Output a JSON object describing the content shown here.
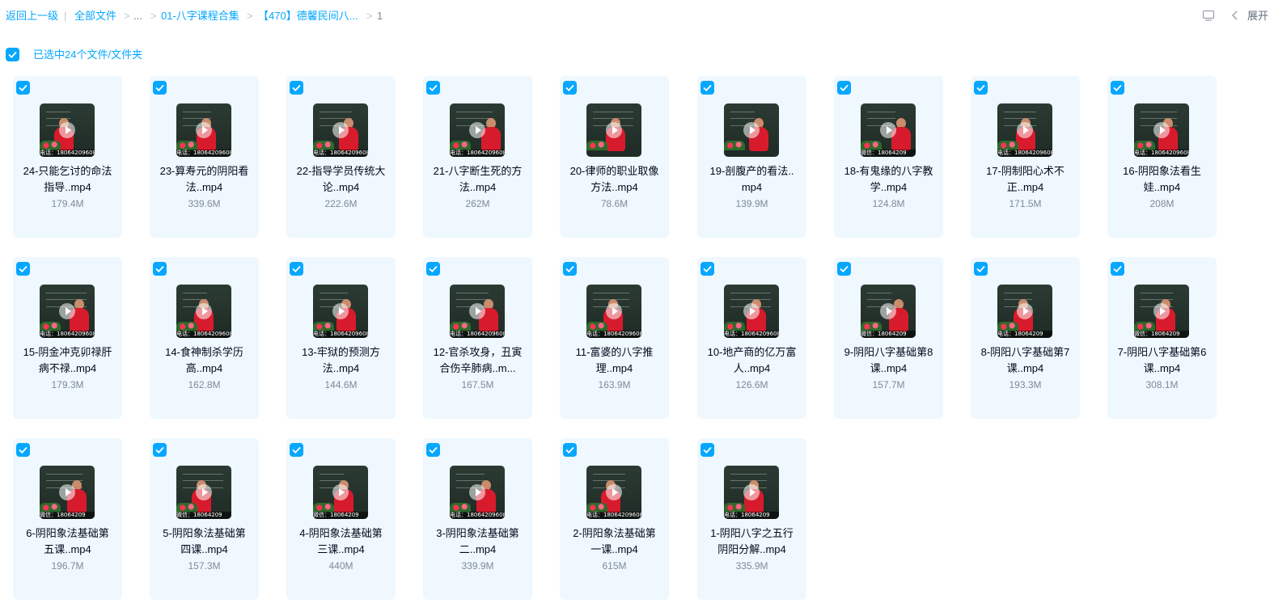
{
  "breadcrumb": {
    "back": "返回上一级",
    "divider": "|",
    "all_files": "全部文件",
    "ellipsis": "...",
    "chevron": ">",
    "folder1": "01-八字课程合集",
    "folder2": "【470】德馨民间八...",
    "current": "1"
  },
  "toolbar": {
    "expand_label": "展开",
    "icon_view": "panel-icon",
    "icon_chevron": "chevron-left-icon"
  },
  "selection": {
    "label": "已选中24个文件/文件夹",
    "checked": true
  },
  "colors": {
    "accent": "#06a7ff",
    "card_bg": "#eef8fe",
    "muted": "#818999"
  },
  "files": [
    {
      "name": "24-只能乞讨的命法指导..mp4",
      "size": "179.4M",
      "wm": "电话：18064209608"
    },
    {
      "name": "23-算寿元的阴阳看法..mp4",
      "size": "339.6M",
      "wm": "电话：18064209608"
    },
    {
      "name": "22-指导学员传统大论..mp4",
      "size": "222.6M",
      "wm": "电话：18064209608"
    },
    {
      "name": "21-八字断生死的方法..mp4",
      "size": "262M",
      "wm": "电话：18064209608"
    },
    {
      "name": "20-律师的职业取像方法..mp4",
      "size": "78.6M",
      "wm": ""
    },
    {
      "name": "19-剖腹产的看法..mp4",
      "size": "139.9M",
      "wm": ""
    },
    {
      "name": "18-有鬼缘的八字教学..mp4",
      "size": "124.8M",
      "wm": "微信：18064209"
    },
    {
      "name": "17-阴制阳心术不正..mp4",
      "size": "171.5M",
      "wm": "电话：18064209608"
    },
    {
      "name": "16-阴阳象法看生娃..mp4",
      "size": "208M",
      "wm": "电话：18064209608"
    },
    {
      "name": "15-阴金冲克卯禄肝病不禄..mp4",
      "size": "179.3M",
      "wm": "电话：18064209608"
    },
    {
      "name": "14-食神制杀学历高..mp4",
      "size": "162.8M",
      "wm": "电话：18064209608"
    },
    {
      "name": "13-牢狱的预测方法..mp4",
      "size": "144.6M",
      "wm": "电话：18064209608"
    },
    {
      "name": "12-官杀攻身，丑寅合伤辛肺病..m...",
      "size": "167.5M",
      "wm": "电话：18064209608"
    },
    {
      "name": "11-富婆的八字推理..mp4",
      "size": "163.9M",
      "wm": "电话：18064209608"
    },
    {
      "name": "10-地产商的亿万富人..mp4",
      "size": "126.6M",
      "wm": "电话：18064209608"
    },
    {
      "name": "9-阴阳八字基础第8课..mp4",
      "size": "157.7M",
      "wm": "微信：18064209"
    },
    {
      "name": "8-阴阳八字基础第7课..mp4",
      "size": "193.3M",
      "wm": "电话：18064209"
    },
    {
      "name": "7-阴阳八字基础第6课..mp4",
      "size": "308.1M",
      "wm": "微信：18064209"
    },
    {
      "name": "6-阴阳象法基础第五课..mp4",
      "size": "196.7M",
      "wm": "微信：18064209"
    },
    {
      "name": "5-阴阳象法基础第四课..mp4",
      "size": "157.3M",
      "wm": "微信：18064209"
    },
    {
      "name": "4-阴阳象法基础第三课..mp4",
      "size": "440M",
      "wm": "微信：18064209"
    },
    {
      "name": "3-阴阳象法基础第二..mp4",
      "size": "339.9M",
      "wm": "电话：18064209608"
    },
    {
      "name": "2-阴阳象法基础第一课..mp4",
      "size": "615M",
      "wm": "电话：18064209608"
    },
    {
      "name": "1-阴阳八字之五行阴阳分解..mp4",
      "size": "335.9M",
      "wm": "电话：18064209"
    }
  ]
}
